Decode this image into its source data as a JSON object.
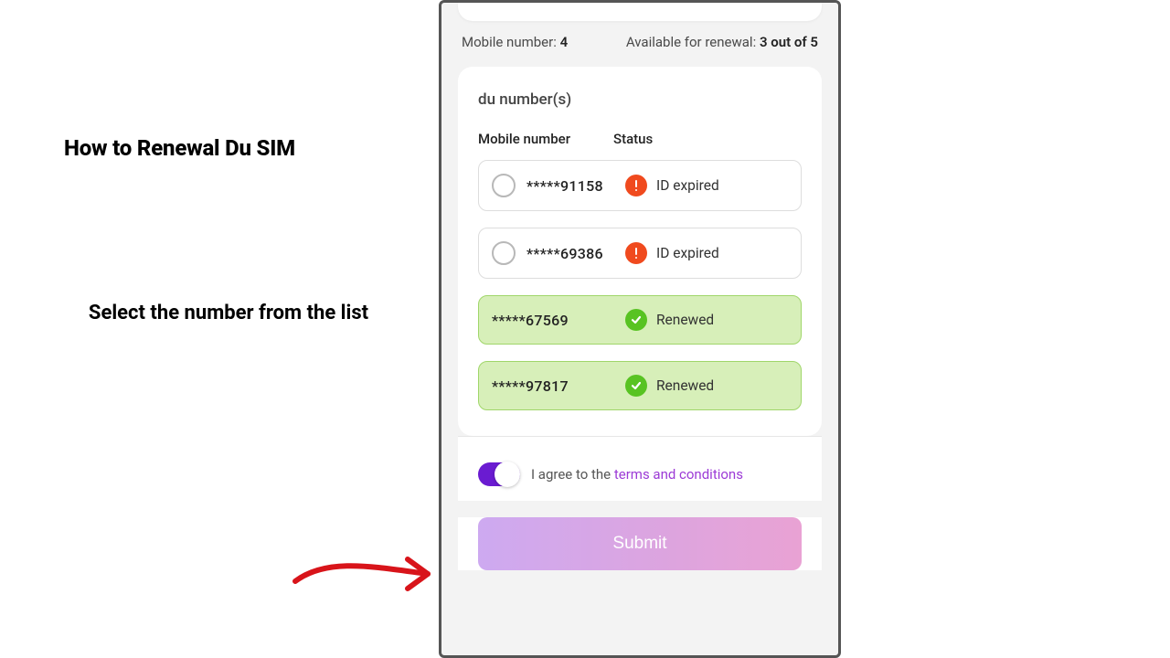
{
  "annotations": {
    "title": "How to Renewal Du SIM",
    "subtitle": "Select the number from the list"
  },
  "summary": {
    "mobile_label": "Mobile number:",
    "mobile_count": "4",
    "avail_label": "Available for renewal:",
    "avail_value": "3 out of 5"
  },
  "card": {
    "title": "du number(s)",
    "col1": "Mobile number",
    "col2": "Status"
  },
  "rows": [
    {
      "number": "*****91158",
      "status": "ID expired",
      "kind": "expired"
    },
    {
      "number": "*****69386",
      "status": "ID expired",
      "kind": "expired"
    },
    {
      "number": "*****67569",
      "status": "Renewed",
      "kind": "renewed"
    },
    {
      "number": "*****97817",
      "status": "Renewed",
      "kind": "renewed"
    }
  ],
  "agree": {
    "prefix": "I agree to the ",
    "link": "terms and conditions"
  },
  "submit_label": "Submit"
}
